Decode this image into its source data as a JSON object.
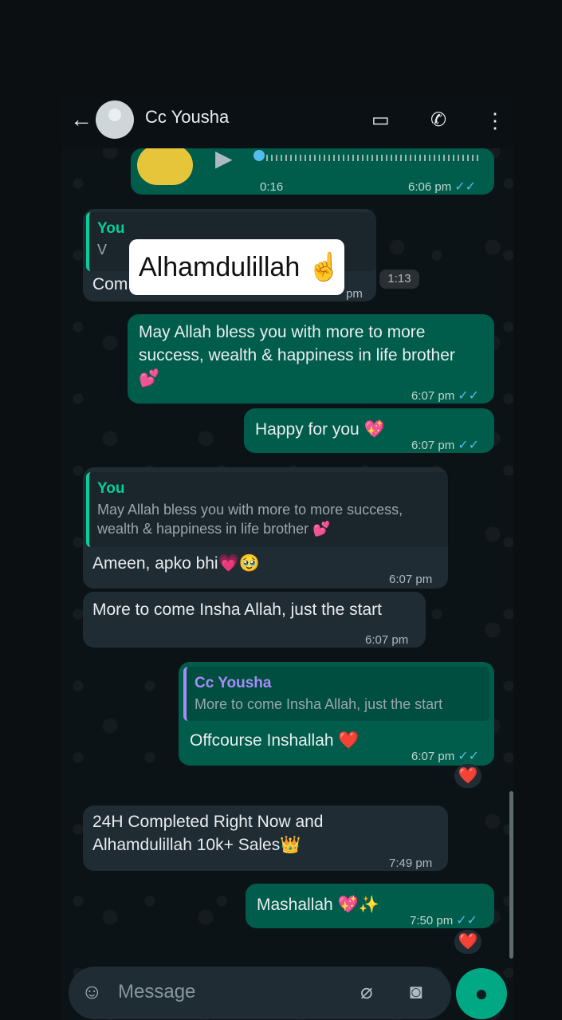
{
  "header": {
    "contact_name": "Cc Yousha"
  },
  "voice_note": {
    "duration": "0:16",
    "time": "6:06 pm"
  },
  "reply_you_1": {
    "quote_name": "You",
    "quote_text": "V",
    "body_fragment": "Com",
    "time": "pm",
    "media_badge": "1:13"
  },
  "sticker": {
    "text": "Alhamdulillah ☝"
  },
  "messages": [
    {
      "text": "May Allah bless you with more to more success, wealth & happiness in life brother 💕",
      "time": "6:07 pm"
    },
    {
      "text": "Happy for you 💖",
      "time": "6:07 pm"
    },
    {
      "quote_name": "You",
      "quote_text": "May Allah bless you with more to more success, wealth & happiness in life brother 💕",
      "text": "Ameen, apko bhi💗🥹",
      "time": "6:07 pm"
    },
    {
      "text": "More to come Insha Allah, just the start",
      "time": "6:07 pm"
    },
    {
      "quote_name": "Cc Yousha",
      "quote_text": "More to come Insha Allah, just the start",
      "text": "Offcourse Inshallah ❤️",
      "time": "6:07 pm",
      "reaction": "❤️"
    },
    {
      "text": "24H Completed Right Now and Alhamdulillah 10k+ Sales👑",
      "time": "7:49 pm"
    },
    {
      "text": "Mashallah 💖✨",
      "time": "7:50 pm",
      "reaction": "❤️"
    }
  ],
  "input": {
    "placeholder": "Message"
  },
  "icons": {
    "back": "arrow-left-icon",
    "video": "video-call-icon",
    "call": "phone-icon",
    "menu": "more-vert-icon",
    "emoji": "sticker-icon",
    "attach": "paperclip-icon",
    "camera": "camera-icon",
    "mic": "mic-icon"
  }
}
